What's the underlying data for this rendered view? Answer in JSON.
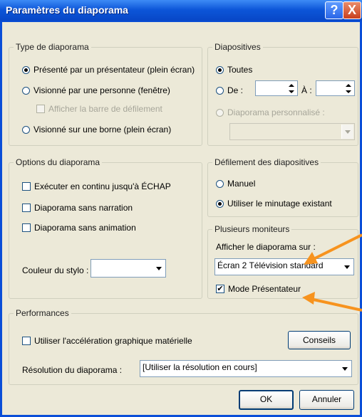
{
  "window": {
    "title": "Paramètres du diaporama",
    "help_label": "?",
    "close_label": "X"
  },
  "type_diaporama": {
    "label": "Type de diaporama",
    "options": [
      {
        "label": "Présenté par un présentateur (plein écran)",
        "selected": true
      },
      {
        "label": "Visionné par une personne (fenêtre)",
        "selected": false
      },
      {
        "label": "Visionné sur une borne (plein écran)",
        "selected": false
      }
    ],
    "scrollbar_check": {
      "label": "Afficher la barre de défilement",
      "checked": false,
      "disabled": true
    }
  },
  "diapositives": {
    "label": "Diapositives",
    "all_label": "Toutes",
    "from_label": "De :",
    "to_label": "À :",
    "from_value": "",
    "to_value": "",
    "custom_label": "Diaporama personnalisé :",
    "custom_value": ""
  },
  "options_diaporama": {
    "label": "Options du diaporama",
    "checks": [
      {
        "label": "Exécuter en continu jusqu'à ÉCHAP",
        "checked": false
      },
      {
        "label": "Diaporama sans narration",
        "checked": false
      },
      {
        "label": "Diaporama sans animation",
        "checked": false
      }
    ],
    "pen_color_label": "Couleur du stylo :",
    "pen_color_value": ""
  },
  "defilement": {
    "label": "Défilement des diapositives",
    "manual_label": "Manuel",
    "timing_label": "Utiliser le minutage existant",
    "selected": "timing"
  },
  "moniteurs": {
    "label": "Plusieurs moniteurs",
    "display_on_label": "Afficher le diaporama sur :",
    "display_on_value": "Écran 2 Télévision standard",
    "presenter_mode_label": "Mode Présentateur",
    "presenter_mode_checked": true,
    "check_mark": "✔"
  },
  "performances": {
    "label": "Performances",
    "hw_accel_label": "Utiliser l'accélération graphique matérielle",
    "hw_accel_checked": false,
    "tips_button": "Conseils",
    "resolution_label": "Résolution du diaporama :",
    "resolution_value": "[Utiliser la résolution en cours]"
  },
  "footer": {
    "ok_label": "OK",
    "cancel_label": "Annuler"
  },
  "colors": {
    "titlebar": "#0A4ED8",
    "dialog_bg": "#ECE9D8",
    "annotation_arrow": "#F7931E"
  }
}
